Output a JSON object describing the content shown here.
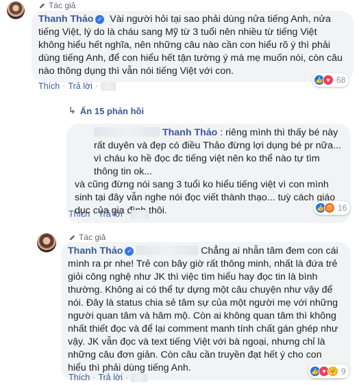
{
  "comment1": {
    "badge": "Tác giả",
    "author": "Thanh Thảo",
    "text": "Vài người hỏi tại sao phải dùng nửa tiếng Anh, nửa tiếng Việt, lý do là cháu sang Mỹ từ 3 tuổi nên nhiều từ tiếng Việt không hiểu hết nghĩa, nên những câu nào cần con hiểu rõ ý thì phải dùng tiếng Anh, để con hiểu hết tận tường ý mà mẹ muốn nói, còn câu nào thông dụng thì vẫn nói tiếng Việt với con.",
    "like": "Thích",
    "reply": "Trả lời",
    "reaction_count": "68"
  },
  "hidden_replies": {
    "label": "Ẩn 15 phản hồi"
  },
  "comment2": {
    "mention": "Thanh Thảo",
    "text1": "riêng mình thì thấy bé này rất duyên và đẹp có điều Thảo đừng lợi dụng bé pr nữa... vì cháu ko hề đọc đc tiếng việt nên ko thể nào tự tìm thông tin ok...",
    "text2": "và cũng đừng nói sang 3 tuổi ko hiểu tiếng việt vì con mình sinh tại đây vẫn nghe nói đọc viết thành thạo... tuỳ cách giáo dục của gia đình thôi.",
    "like": "Thích",
    "reply": "Trả lời",
    "reaction_count": "16"
  },
  "comment3": {
    "badge": "Tác giả",
    "author": "Thanh Thảo",
    "text": "Chẳng ai nhẫn tâm đem con cái mình ra pr nhe! Trẻ con bây giờ rất thông minh, nhất là đứa trẻ giỏi công nghệ như JK thì việc tìm hiểu hay đọc tin là bình thường. Không ai có thể tự dựng một câu chuyện như vậy để nói. Đây là status chia sẻ tâm sự của một người mẹ với những người quan tâm và hâm mộ. Còn ai không quan tâm thì không nhất thiết đọc và để lại comment manh tính chất gán ghép như vậy. JK vẫn đọc và text tiếng Việt với bà ngoại, nhưng chỉ là những câu đơn giản. Còn câu cần truyền đạt hết ý cho con hiểu thì phải dùng tiếng Anh.",
    "like": "Thích",
    "reply": "Trả lời",
    "reaction_count": "9"
  },
  "colors": {
    "link": "#385898",
    "bubble": "#f2f3f5",
    "like": "#1877f2",
    "love": "#f33e58"
  }
}
